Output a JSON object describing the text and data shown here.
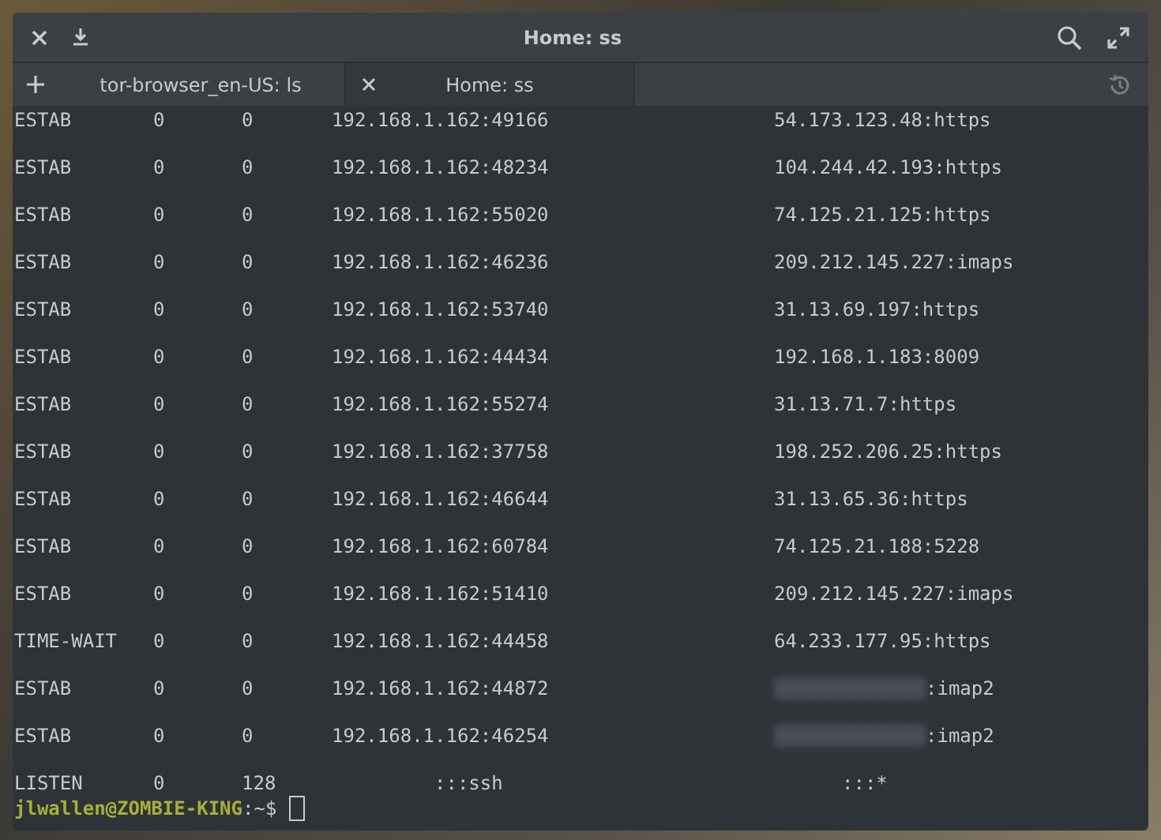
{
  "window": {
    "title": "Home: ss"
  },
  "tabs": [
    {
      "label": "tor-browser_en-US: ls",
      "selected": false
    },
    {
      "label": "Home: ss",
      "selected": true
    }
  ],
  "rows": [
    {
      "kind": "estab",
      "state": "ESTAB",
      "recv_q": "0",
      "send_q": "0",
      "local": "192.168.1.162:49166",
      "peer": "54.173.123.48:https",
      "peer_redacted": false
    },
    {
      "kind": "estab",
      "state": "ESTAB",
      "recv_q": "0",
      "send_q": "0",
      "local": "192.168.1.162:48234",
      "peer": "104.244.42.193:https",
      "peer_redacted": false
    },
    {
      "kind": "estab",
      "state": "ESTAB",
      "recv_q": "0",
      "send_q": "0",
      "local": "192.168.1.162:55020",
      "peer": "74.125.21.125:https",
      "peer_redacted": false
    },
    {
      "kind": "estab",
      "state": "ESTAB",
      "recv_q": "0",
      "send_q": "0",
      "local": "192.168.1.162:46236",
      "peer": "209.212.145.227:imaps",
      "peer_redacted": false
    },
    {
      "kind": "estab",
      "state": "ESTAB",
      "recv_q": "0",
      "send_q": "0",
      "local": "192.168.1.162:53740",
      "peer": "31.13.69.197:https",
      "peer_redacted": false
    },
    {
      "kind": "estab",
      "state": "ESTAB",
      "recv_q": "0",
      "send_q": "0",
      "local": "192.168.1.162:44434",
      "peer": "192.168.1.183:8009",
      "peer_redacted": false
    },
    {
      "kind": "estab",
      "state": "ESTAB",
      "recv_q": "0",
      "send_q": "0",
      "local": "192.168.1.162:55274",
      "peer": "31.13.71.7:https",
      "peer_redacted": false
    },
    {
      "kind": "estab",
      "state": "ESTAB",
      "recv_q": "0",
      "send_q": "0",
      "local": "192.168.1.162:37758",
      "peer": "198.252.206.25:https",
      "peer_redacted": false
    },
    {
      "kind": "estab",
      "state": "ESTAB",
      "recv_q": "0",
      "send_q": "0",
      "local": "192.168.1.162:46644",
      "peer": "31.13.65.36:https",
      "peer_redacted": false
    },
    {
      "kind": "estab",
      "state": "ESTAB",
      "recv_q": "0",
      "send_q": "0",
      "local": "192.168.1.162:60784",
      "peer": "74.125.21.188:5228",
      "peer_redacted": false
    },
    {
      "kind": "estab",
      "state": "ESTAB",
      "recv_q": "0",
      "send_q": "0",
      "local": "192.168.1.162:51410",
      "peer": "209.212.145.227:imaps",
      "peer_redacted": false
    },
    {
      "kind": "estab",
      "state": "TIME-WAIT",
      "recv_q": "0",
      "send_q": "0",
      "local": "192.168.1.162:44458",
      "peer": "64.233.177.95:https",
      "peer_redacted": false
    },
    {
      "kind": "estab",
      "state": "ESTAB",
      "recv_q": "0",
      "send_q": "0",
      "local": "192.168.1.162:44872",
      "peer": ":imap2",
      "peer_redacted": true
    },
    {
      "kind": "estab",
      "state": "ESTAB",
      "recv_q": "0",
      "send_q": "0",
      "local": "192.168.1.162:46254",
      "peer": ":imap2",
      "peer_redacted": true
    },
    {
      "kind": "listen",
      "state": "LISTEN",
      "recv_q": "0",
      "send_q": "128",
      "local": ":::ssh",
      "peer": ":::*",
      "peer_redacted": false
    }
  ],
  "prompt": {
    "user_host": "jlwallen@ZOMBIE-KING",
    "path": ":~$"
  }
}
